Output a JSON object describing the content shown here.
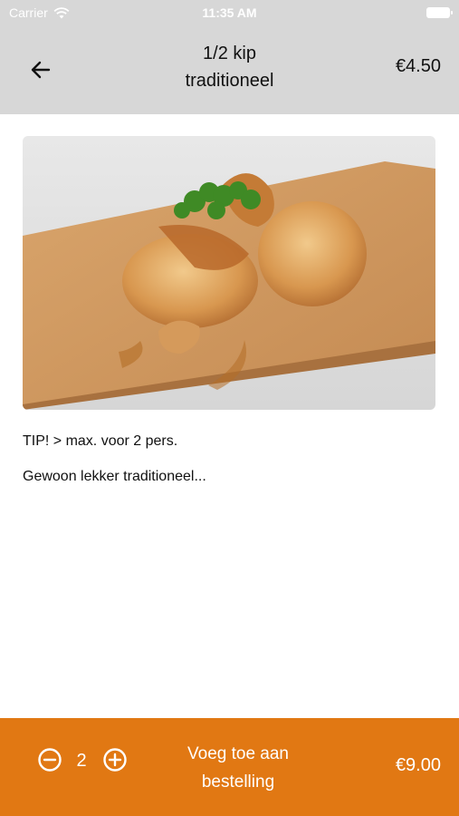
{
  "status_bar": {
    "carrier": "Carrier",
    "time": "11:35 AM"
  },
  "header": {
    "title_line1": "1/2 kip",
    "title_line2": "traditioneel",
    "price": "€4.50"
  },
  "product": {
    "tip": "TIP! > max. voor 2 pers.",
    "description": "Gewoon lekker traditioneel..."
  },
  "bottom_bar": {
    "quantity": "2",
    "add_label_line1": "Voeg toe aan",
    "add_label_line2": "bestelling",
    "total": "€9.00"
  },
  "colors": {
    "accent": "#e17813",
    "header_bg": "#d7d7d7"
  }
}
